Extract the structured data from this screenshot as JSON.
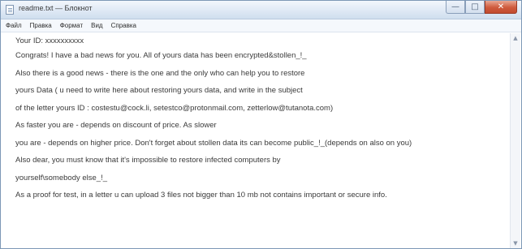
{
  "window": {
    "title": "readme.txt — Блокнот",
    "buttons": {
      "minimize": "—",
      "maximize": "□",
      "close": "✕"
    }
  },
  "menu": {
    "items": [
      {
        "label": "Файл"
      },
      {
        "label": "Правка"
      },
      {
        "label": "Формат"
      },
      {
        "label": "Вид"
      },
      {
        "label": "Справка"
      }
    ]
  },
  "document": {
    "lines": [
      "Your ID: xxxxxxxxxx",
      "Congrats! I have a bad news for you. All of yours data has been encrypted&stollen_!_",
      "Also there is a good news - there is the one and the only who can help you to restore",
      "yours Data ( u need to write here about restoring yours data, and write in the subject",
      "of the letter yours ID : costestu@cock.li, setestco@protonmail.com, zetterlow@tutanota.com)",
      "As faster you are - depends on discount of price. As slower",
      "you are - depends on higher price. Don't forget about stollen data its can become public_!_(depends on also on you)",
      "Also dear, you must know that it's impossible to restore infected computers by",
      "yourself\\somebody else_!_",
      "As a proof for test, in a letter  u can upload 3 files not bigger than 10 mb not contains important or secure info."
    ]
  },
  "scrollbar": {
    "up_arrow": "▲",
    "down_arrow": "▼"
  }
}
